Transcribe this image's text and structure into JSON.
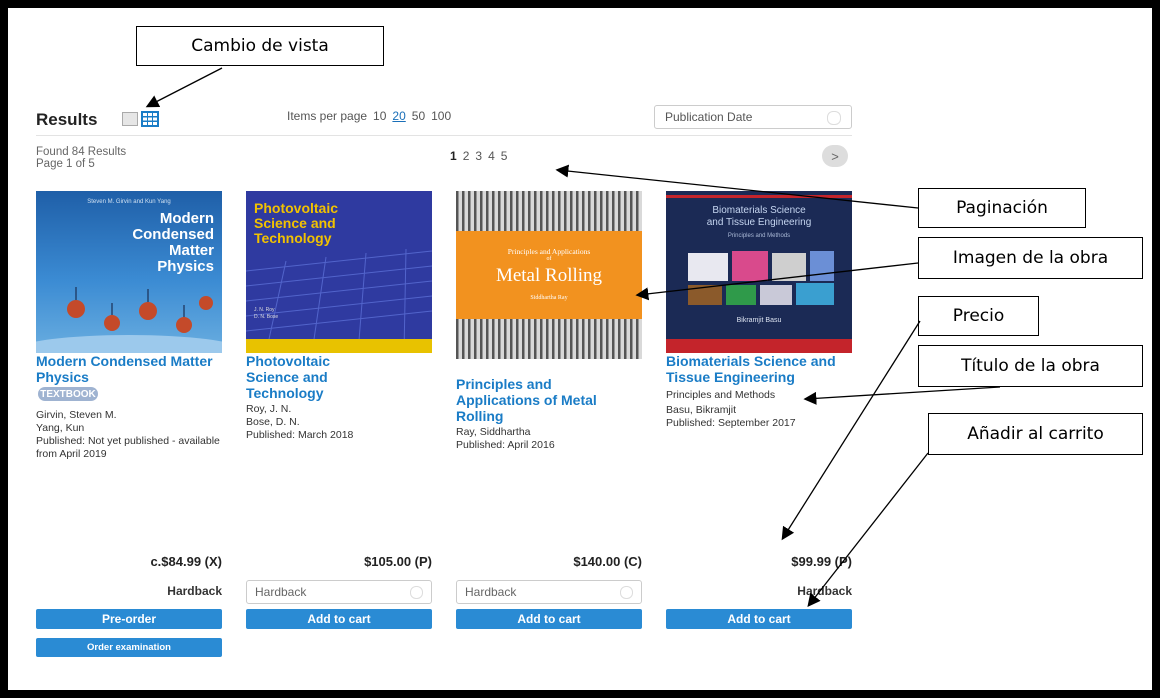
{
  "results": {
    "title": "Results",
    "found": "Found 84 Results",
    "page_of": "Page 1 of 5",
    "items_per_page_label": "Items per page",
    "items_per_page_options": [
      "10",
      "20",
      "50",
      "100"
    ],
    "items_per_page_selected": "20",
    "sort": "Publication Date",
    "pages": [
      "1",
      "2",
      "3",
      "4",
      "5"
    ],
    "current_page": "1",
    "next_icon": ">"
  },
  "books": [
    {
      "title": "Modern Condensed Matter Physics",
      "badge": "TEXTBOOK",
      "authors": [
        "Girvin, Steven M.",
        "Yang, Kun"
      ],
      "published": "Published: Not yet published - available from April 2019",
      "price": "c.$84.99 (X)",
      "format": "Hardback",
      "button": "Pre-order",
      "button2": "Order examination",
      "cover": {
        "authors_line": "Steven M. Girvin and Kun Yang",
        "title_lines": [
          "Modern",
          "Condensed",
          "Matter",
          "Physics"
        ]
      }
    },
    {
      "title": "Photovoltaic Science and Technology",
      "authors": [
        "Roy, J. N.",
        "Bose, D. N."
      ],
      "published": "Published: March 2018",
      "price": "$105.00 (P)",
      "format": "Hardback",
      "button": "Add to cart",
      "cover": {
        "title_lines": [
          "Photovoltaic",
          "Science and",
          "Technology"
        ],
        "authors_lines": [
          "J. N. Roy",
          "D. N. Bose"
        ]
      }
    },
    {
      "title": "Principles and Applications of Metal Rolling",
      "authors": [
        "Ray, Siddhartha"
      ],
      "published": "Published: April 2016",
      "price": "$140.00 (C)",
      "format": "Hardback",
      "button": "Add to cart",
      "cover": {
        "subtitle": "Principles and Applications",
        "of": "of",
        "title": "Metal Rolling",
        "author": "Siddhartha Ray"
      }
    },
    {
      "title": "Biomaterials Science and Tissue Engineering",
      "subtitle": "Principles and Methods",
      "authors": [
        "Basu, Bikramjit"
      ],
      "published": "Published: September 2017",
      "price": "$99.99 (P)",
      "format": "Hardback",
      "button": "Add to cart",
      "cover": {
        "title_lines": [
          "Biomaterials Science",
          "and Tissue Engineering"
        ],
        "subtitle": "Principles and Methods",
        "author": "Bikramjit Basu"
      }
    }
  ],
  "annotations": {
    "view_change": "Cambio de vista",
    "pagination": "Paginación",
    "image": "Imagen de la obra",
    "price": "Precio",
    "title": "Título de la obra",
    "add_cart": "Añadir al carrito"
  },
  "colors": {
    "link": "#1a7cc6",
    "button": "#2a8bd4",
    "badge": "#9fb3d1",
    "cover_blue": "#2d6fb3",
    "cover_orange": "#f2921f"
  }
}
